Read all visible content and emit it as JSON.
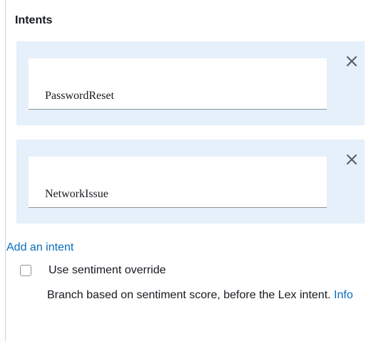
{
  "section": {
    "title": "Intents"
  },
  "intents": [
    {
      "value": "PasswordReset",
      "remove_icon": "close-icon"
    },
    {
      "value": "NetworkIssue",
      "remove_icon": "close-icon"
    }
  ],
  "add_intent_label": "Add an intent",
  "sentiment_override": {
    "label": "Use sentiment override",
    "checked": false,
    "description": "Branch based on sentiment score, before the Lex intent.",
    "info_label": "Info"
  },
  "colors": {
    "card_background": "#e6f0fa",
    "link": "#0a6ebd",
    "text": "#16191f"
  }
}
